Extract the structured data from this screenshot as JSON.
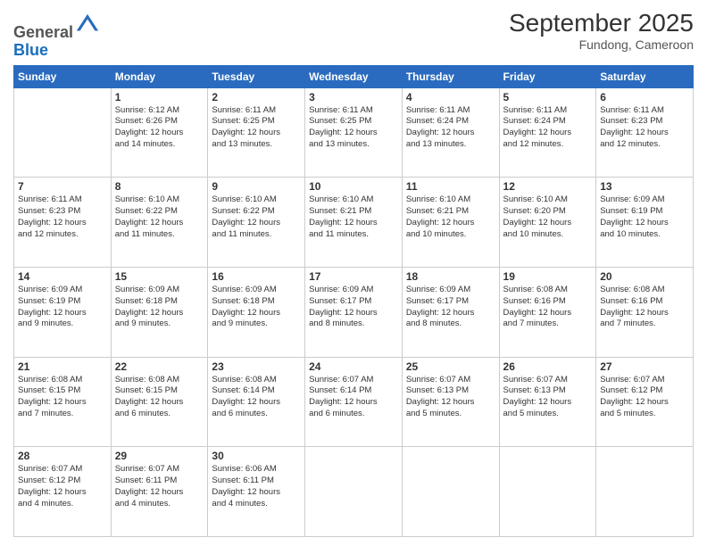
{
  "header": {
    "logo_general": "General",
    "logo_blue": "Blue",
    "month_title": "September 2025",
    "location": "Fundong, Cameroon"
  },
  "days_of_week": [
    "Sunday",
    "Monday",
    "Tuesday",
    "Wednesday",
    "Thursday",
    "Friday",
    "Saturday"
  ],
  "weeks": [
    [
      {
        "day": "",
        "info": ""
      },
      {
        "day": "1",
        "info": "Sunrise: 6:12 AM\nSunset: 6:26 PM\nDaylight: 12 hours\nand 14 minutes."
      },
      {
        "day": "2",
        "info": "Sunrise: 6:11 AM\nSunset: 6:25 PM\nDaylight: 12 hours\nand 13 minutes."
      },
      {
        "day": "3",
        "info": "Sunrise: 6:11 AM\nSunset: 6:25 PM\nDaylight: 12 hours\nand 13 minutes."
      },
      {
        "day": "4",
        "info": "Sunrise: 6:11 AM\nSunset: 6:24 PM\nDaylight: 12 hours\nand 13 minutes."
      },
      {
        "day": "5",
        "info": "Sunrise: 6:11 AM\nSunset: 6:24 PM\nDaylight: 12 hours\nand 12 minutes."
      },
      {
        "day": "6",
        "info": "Sunrise: 6:11 AM\nSunset: 6:23 PM\nDaylight: 12 hours\nand 12 minutes."
      }
    ],
    [
      {
        "day": "7",
        "info": "Sunrise: 6:11 AM\nSunset: 6:23 PM\nDaylight: 12 hours\nand 12 minutes."
      },
      {
        "day": "8",
        "info": "Sunrise: 6:10 AM\nSunset: 6:22 PM\nDaylight: 12 hours\nand 11 minutes."
      },
      {
        "day": "9",
        "info": "Sunrise: 6:10 AM\nSunset: 6:22 PM\nDaylight: 12 hours\nand 11 minutes."
      },
      {
        "day": "10",
        "info": "Sunrise: 6:10 AM\nSunset: 6:21 PM\nDaylight: 12 hours\nand 11 minutes."
      },
      {
        "day": "11",
        "info": "Sunrise: 6:10 AM\nSunset: 6:21 PM\nDaylight: 12 hours\nand 10 minutes."
      },
      {
        "day": "12",
        "info": "Sunrise: 6:10 AM\nSunset: 6:20 PM\nDaylight: 12 hours\nand 10 minutes."
      },
      {
        "day": "13",
        "info": "Sunrise: 6:09 AM\nSunset: 6:19 PM\nDaylight: 12 hours\nand 10 minutes."
      }
    ],
    [
      {
        "day": "14",
        "info": "Sunrise: 6:09 AM\nSunset: 6:19 PM\nDaylight: 12 hours\nand 9 minutes."
      },
      {
        "day": "15",
        "info": "Sunrise: 6:09 AM\nSunset: 6:18 PM\nDaylight: 12 hours\nand 9 minutes."
      },
      {
        "day": "16",
        "info": "Sunrise: 6:09 AM\nSunset: 6:18 PM\nDaylight: 12 hours\nand 9 minutes."
      },
      {
        "day": "17",
        "info": "Sunrise: 6:09 AM\nSunset: 6:17 PM\nDaylight: 12 hours\nand 8 minutes."
      },
      {
        "day": "18",
        "info": "Sunrise: 6:09 AM\nSunset: 6:17 PM\nDaylight: 12 hours\nand 8 minutes."
      },
      {
        "day": "19",
        "info": "Sunrise: 6:08 AM\nSunset: 6:16 PM\nDaylight: 12 hours\nand 7 minutes."
      },
      {
        "day": "20",
        "info": "Sunrise: 6:08 AM\nSunset: 6:16 PM\nDaylight: 12 hours\nand 7 minutes."
      }
    ],
    [
      {
        "day": "21",
        "info": "Sunrise: 6:08 AM\nSunset: 6:15 PM\nDaylight: 12 hours\nand 7 minutes."
      },
      {
        "day": "22",
        "info": "Sunrise: 6:08 AM\nSunset: 6:15 PM\nDaylight: 12 hours\nand 6 minutes."
      },
      {
        "day": "23",
        "info": "Sunrise: 6:08 AM\nSunset: 6:14 PM\nDaylight: 12 hours\nand 6 minutes."
      },
      {
        "day": "24",
        "info": "Sunrise: 6:07 AM\nSunset: 6:14 PM\nDaylight: 12 hours\nand 6 minutes."
      },
      {
        "day": "25",
        "info": "Sunrise: 6:07 AM\nSunset: 6:13 PM\nDaylight: 12 hours\nand 5 minutes."
      },
      {
        "day": "26",
        "info": "Sunrise: 6:07 AM\nSunset: 6:13 PM\nDaylight: 12 hours\nand 5 minutes."
      },
      {
        "day": "27",
        "info": "Sunrise: 6:07 AM\nSunset: 6:12 PM\nDaylight: 12 hours\nand 5 minutes."
      }
    ],
    [
      {
        "day": "28",
        "info": "Sunrise: 6:07 AM\nSunset: 6:12 PM\nDaylight: 12 hours\nand 4 minutes."
      },
      {
        "day": "29",
        "info": "Sunrise: 6:07 AM\nSunset: 6:11 PM\nDaylight: 12 hours\nand 4 minutes."
      },
      {
        "day": "30",
        "info": "Sunrise: 6:06 AM\nSunset: 6:11 PM\nDaylight: 12 hours\nand 4 minutes."
      },
      {
        "day": "",
        "info": ""
      },
      {
        "day": "",
        "info": ""
      },
      {
        "day": "",
        "info": ""
      },
      {
        "day": "",
        "info": ""
      }
    ]
  ]
}
